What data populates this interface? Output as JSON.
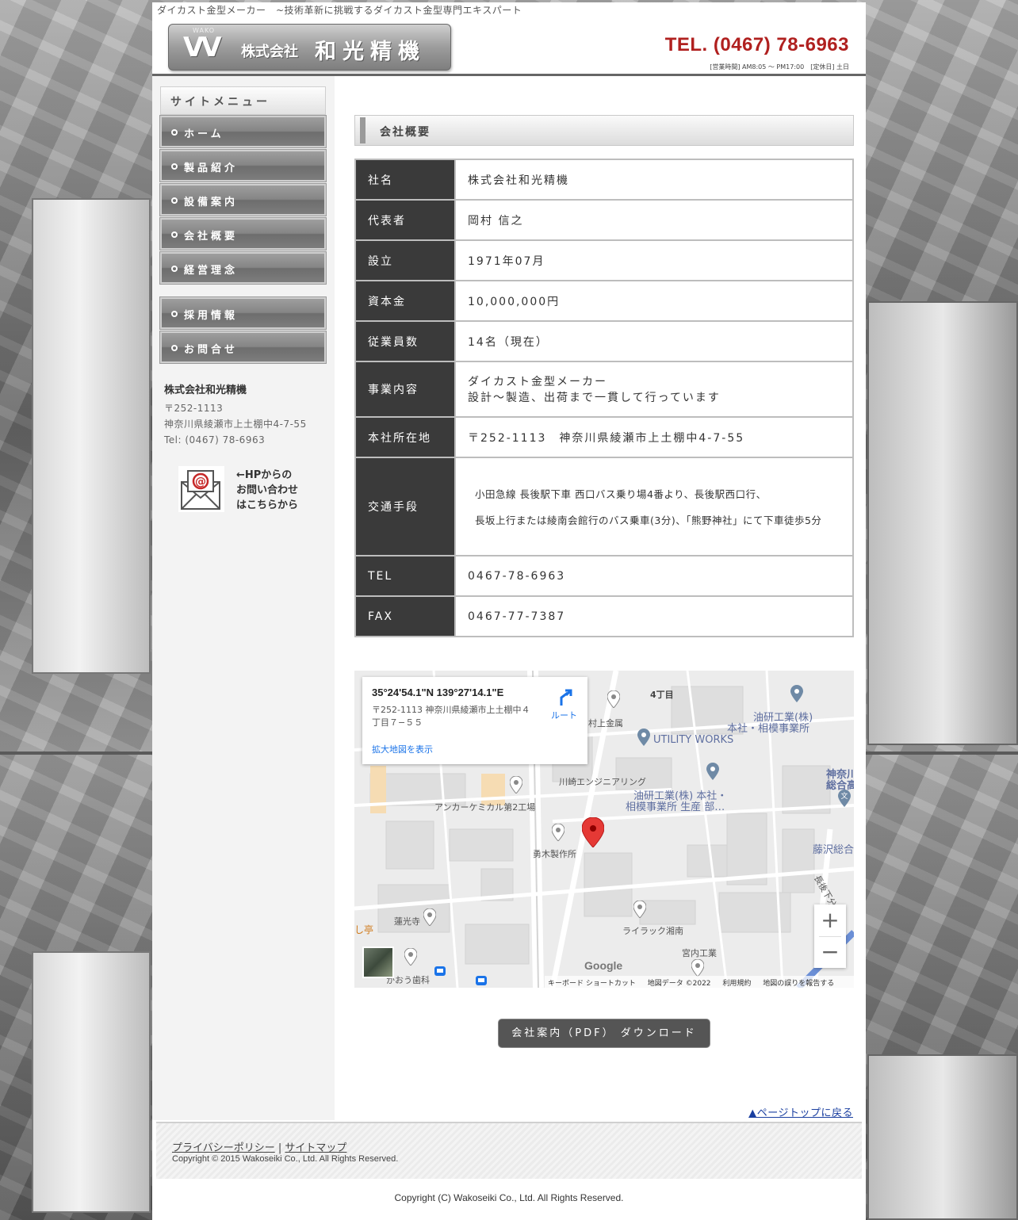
{
  "header": {
    "tagline": "ダイカスト金型メーカー　~技術革新に挑戦するダイカスト金型専門エキスパート",
    "logo_mark": "VV",
    "logo_sub": "WAKO",
    "logo_kabu": "株式会社",
    "logo_name": "和光精機",
    "tel": "TEL. (0467) 78-6963",
    "hours": "[営業時間] AM8:05 ～ PM17:00　[定休日] 土日"
  },
  "sidebar": {
    "menu_title": "サイトメニュー",
    "items": [
      {
        "label": "ホーム"
      },
      {
        "label": "製品紹介"
      },
      {
        "label": "設備案内"
      },
      {
        "label": "会社概要"
      },
      {
        "label": "経営理念"
      },
      {
        "label": "採用情報"
      },
      {
        "label": "お問合せ"
      }
    ],
    "company": {
      "name": "株式会社和光精機",
      "zip": "〒252-1113",
      "address": "神奈川県綾瀬市上土棚中4-7-55",
      "tel": "Tel: (0467) 78-6963"
    },
    "contact": {
      "line1": "←HPからの",
      "line2": "お問い合わせ",
      "line3": "はこちらから"
    }
  },
  "main": {
    "heading": "会社概要",
    "rows": [
      {
        "label": "社名",
        "value": "株式会社和光精機"
      },
      {
        "label": "代表者",
        "value": "岡村 信之"
      },
      {
        "label": "設立",
        "value": "1971年07月"
      },
      {
        "label": "資本金",
        "value": "10,000,000円"
      },
      {
        "label": "従業員数",
        "value": "14名（現在）"
      },
      {
        "label": "事業内容",
        "value": "ダイカスト金型メーカー",
        "value2": "設計～製造、出荷まで一貫して行っています"
      },
      {
        "label": "本社所在地",
        "value": "〒252-1113　神奈川県綾瀬市上土棚中4-7-55"
      },
      {
        "label": "交通手段",
        "value": "小田急線 長後駅下車 西口バス乗り場4番より、長後駅西口行、",
        "value2": "長坂上行または綾南会館行のバス乗車(3分)、「熊野神社」にて下車徒歩5分"
      },
      {
        "label": "TEL",
        "value": "0467-78-6963"
      },
      {
        "label": "FAX",
        "value": "0467-77-7387"
      }
    ],
    "map": {
      "coord": "35°24'54.1\"N 139°27'14.1\"E",
      "address": "〒252-1113 神奈川県綾瀬市上土棚中４丁目７−５５",
      "larger": "拡大地図を表示",
      "route": "ルート",
      "labels": {
        "chome": "4丁目",
        "kamikane": "村上金属",
        "utility": "UTILITY WORKS",
        "yuken1": "油研工業(株)",
        "yuken2": "本社・相模事業所",
        "kawasaki": "川崎エンジニアリング",
        "yuken3": "油研工業(株) 本社・",
        "yuken4": "相模事業所 生産 部…",
        "kanagawa1": "神奈川",
        "kanagawa2": "総合高",
        "anchor": "アンカーケミカル第2工場",
        "yuki": "勇木製作所",
        "fujisawa": "藤沢総合",
        "chogo": "長後下分",
        "renkoji": "蓮光寺",
        "lilac": "ライラック湘南",
        "miyauchi": "宮内工業",
        "dental": "かおう歯科",
        "shitei": "し亭",
        "google": "Google"
      },
      "footer": {
        "keyboard": "キーボード ショートカット",
        "data": "地図データ ©2022",
        "terms": "利用規約",
        "report": "地図の誤りを報告する"
      }
    },
    "pdf_button": "会社案内（PDF） ダウンロード",
    "pagetop": "▲ページトップに戻る"
  },
  "footer": {
    "privacy": "プライバシーポリシー",
    "sep": "|",
    "sitemap": "サイトマップ",
    "copyright1": "Copyright © 2015 Wakoseiki Co., Ltd. All Rights Reserved.",
    "copyright2": "Copyright (C) Wakoseiki Co., Ltd. All Rights Reserved."
  }
}
